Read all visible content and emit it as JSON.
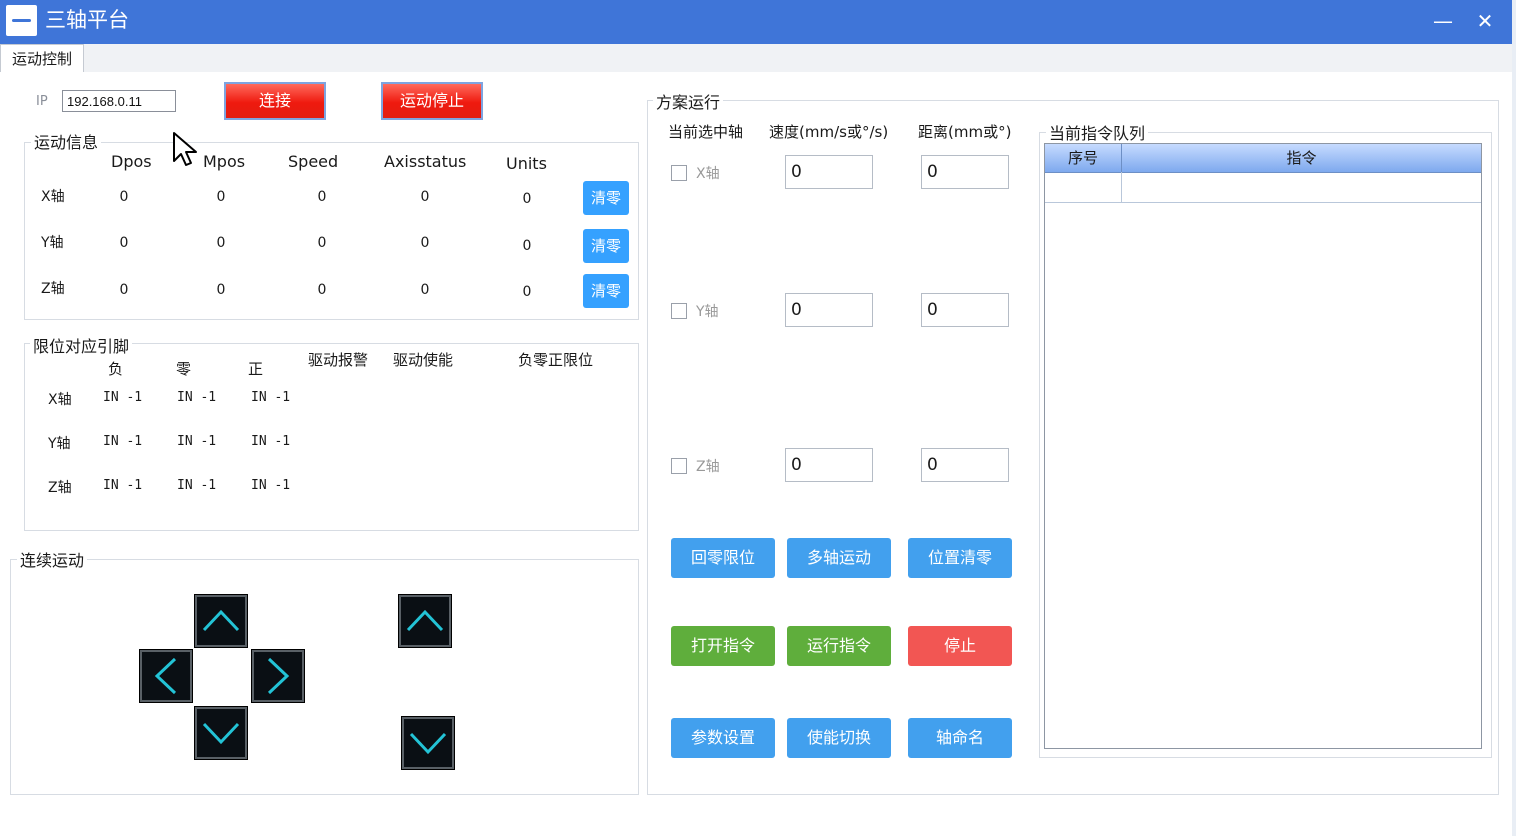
{
  "window": {
    "title": "三轴平台",
    "minimize": "—",
    "close": "✕"
  },
  "tabs": [
    "运动控制"
  ],
  "connection": {
    "ip_label": "IP",
    "ip_value": "192.168.0.11",
    "connect": "连接",
    "stop_motion": "运动停止"
  },
  "motion_info": {
    "title": "运动信息",
    "headers": [
      "Dpos",
      "Mpos",
      "Speed",
      "Axisstatus",
      "Units"
    ],
    "zero_label": "清零",
    "rows": [
      {
        "axis": "X轴",
        "values": [
          "0",
          "0",
          "0",
          "0",
          "0"
        ]
      },
      {
        "axis": "Y轴",
        "values": [
          "0",
          "0",
          "0",
          "0",
          "0"
        ]
      },
      {
        "axis": "Z轴",
        "values": [
          "0",
          "0",
          "0",
          "0",
          "0"
        ]
      }
    ]
  },
  "limits": {
    "title": "限位对应引脚",
    "headers": [
      "负",
      "零",
      "正",
      "驱动报警",
      "驱动使能",
      "负零正限位"
    ],
    "rows": [
      {
        "axis": "X轴",
        "neg": "IN -1",
        "zero": "IN -1",
        "pos": "IN -1"
      },
      {
        "axis": "Y轴",
        "neg": "IN -1",
        "zero": "IN -1",
        "pos": "IN -1"
      },
      {
        "axis": "Z轴",
        "neg": "IN -1",
        "zero": "IN -1",
        "pos": "IN -1"
      }
    ]
  },
  "continuous": {
    "title": "连续运动"
  },
  "plan": {
    "title": "方案运行",
    "col_axis": "当前选中轴",
    "col_speed": "速度(mm/s或°/s)",
    "col_distance": "距离(mm或°)",
    "axes": [
      {
        "label": "X轴",
        "checked": false,
        "speed": "0",
        "distance": "0"
      },
      {
        "label": "Y轴",
        "checked": false,
        "speed": "0",
        "distance": "0"
      },
      {
        "label": "Z轴",
        "checked": false,
        "speed": "0",
        "distance": "0"
      }
    ],
    "buttons": {
      "home_limit": "回零限位",
      "multi_axis": "多轴运动",
      "pos_zero": "位置清零",
      "open_cmd": "打开指令",
      "run_cmd": "运行指令",
      "stop": "停止",
      "param_settings": "参数设置",
      "enable_switch": "使能切换",
      "axis_naming": "轴命名"
    },
    "colors": {
      "blue": "#42a0ee",
      "green": "#5fae3c",
      "red": "#f25653"
    }
  },
  "queue": {
    "title": "当前指令队列",
    "col_index": "序号",
    "col_cmd": "指令",
    "rows": []
  }
}
